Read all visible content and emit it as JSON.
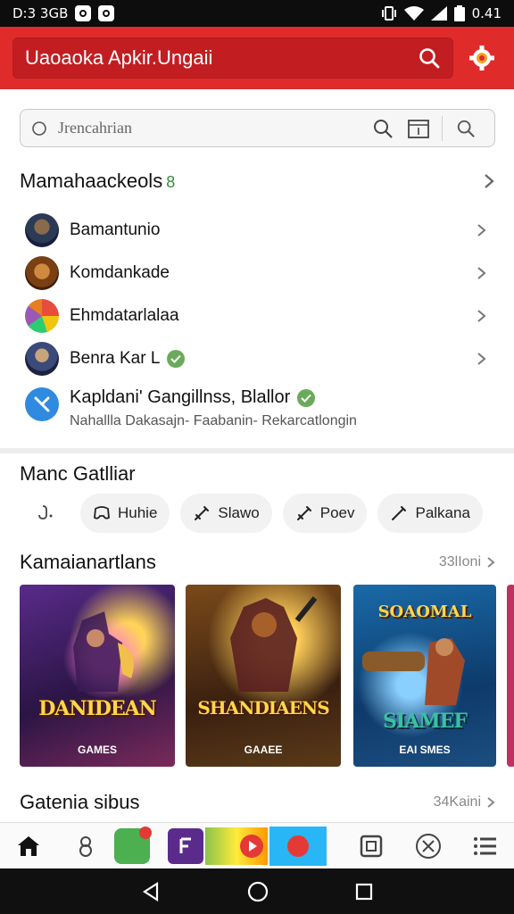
{
  "status": {
    "left": "D:3 3GB",
    "right": "0.41"
  },
  "appbar": {
    "title": "Uaoaoka Apkir.Ungaii"
  },
  "search": {
    "placeholder": "Jrencahrian"
  },
  "section1": {
    "title": "Mamahaackeols",
    "badge": "8",
    "items": [
      {
        "label": "Bamantunio"
      },
      {
        "label": "Komdankade"
      },
      {
        "label": "Ehmdatarlalaa"
      },
      {
        "label": "Benra Kar L"
      }
    ],
    "featured": {
      "title": "Kapldani' Gangillnss, Blallor",
      "subtitle": "Nahallla Dakasajn- Faabanin- Rekarcatlongin"
    }
  },
  "section2": {
    "title": "Manc Gatlliar",
    "chips": [
      {
        "label": "Huhie",
        "icon": "controller-icon"
      },
      {
        "label": "Slawo",
        "icon": "sword-icon"
      },
      {
        "label": "Poev",
        "icon": "sword-icon"
      },
      {
        "label": "Palkana",
        "icon": "sword-icon"
      }
    ]
  },
  "section3": {
    "title": "Kamaianartlans",
    "meta": "33lIoni",
    "cards": [
      {
        "title": "DANIDEAN",
        "subtitle": "GAMES"
      },
      {
        "title": "SHANDIAENS",
        "subtitle": "GAAEE"
      },
      {
        "title": "SIAMEF",
        "subtitle": "EAI SMES",
        "top": "SOAOMAL"
      }
    ]
  },
  "section4": {
    "title": "Gatenia sibus",
    "meta": "34Kaini"
  },
  "colors": {
    "primary": "#e02b2b",
    "primary_dark": "#c21e22",
    "verified": "#6aab5b"
  }
}
